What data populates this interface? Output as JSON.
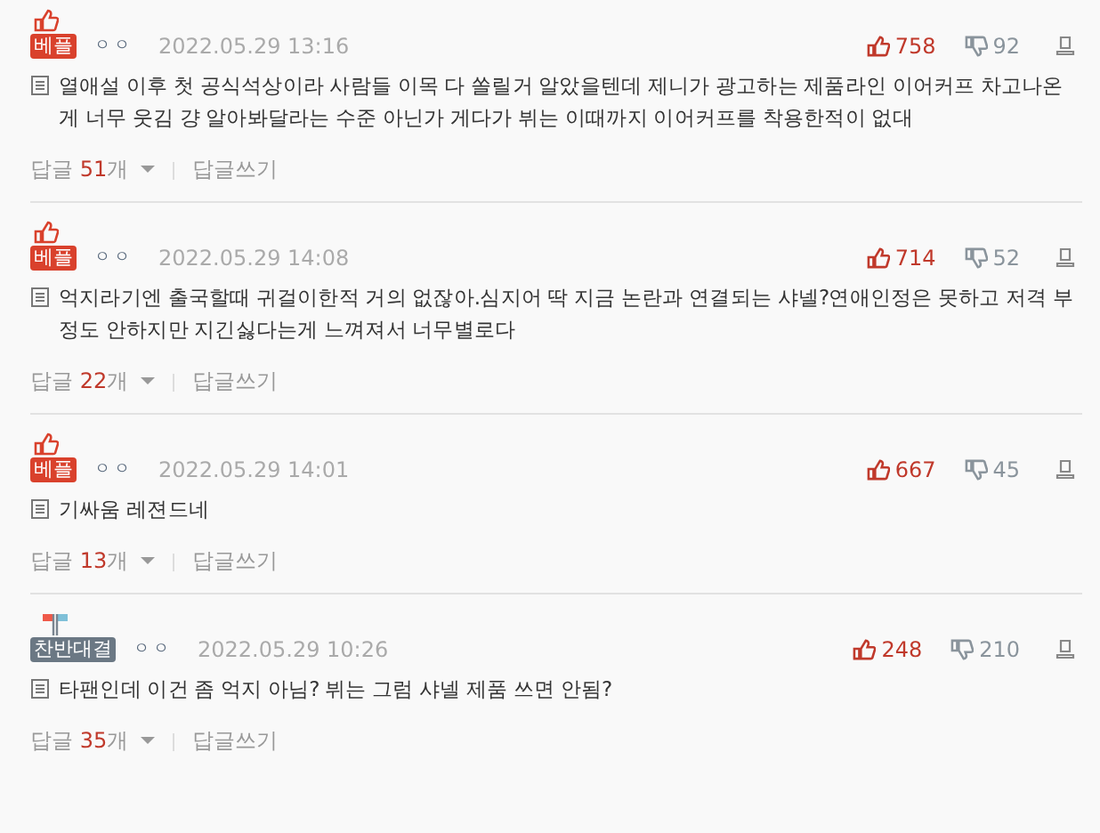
{
  "comments": [
    {
      "badge": {
        "kind": "best",
        "label": "베플"
      },
      "user": "ㅇㅇ",
      "date": "2022.05.29 13:16",
      "likes": "758",
      "dislikes": "92",
      "text": "열애설 이후 첫 공식석상이라 사람들 이목 다 쏠릴거 알았을텐데 제니가 광고하는 제품라인 이어커프 차고나온게 너무 웃김 걍 알아봐달라는 수준 아닌가 게다가 뷔는 이때까지 이어커프를 착용한적이 없대",
      "reply_label": "답글",
      "reply_count": "51",
      "reply_unit": "개",
      "write_reply": "답글쓰기"
    },
    {
      "badge": {
        "kind": "best",
        "label": "베플"
      },
      "user": "ㅇㅇ",
      "date": "2022.05.29 14:08",
      "likes": "714",
      "dislikes": "52",
      "text": "억지라기엔 출국할때 귀걸이한적 거의 없잖아.심지어 딱 지금 논란과 연결되는 샤넬?연애인정은 못하고 저격 부정도 안하지만 지긴싫다는게 느껴져서 너무별로다",
      "reply_label": "답글",
      "reply_count": "22",
      "reply_unit": "개",
      "write_reply": "답글쓰기"
    },
    {
      "badge": {
        "kind": "best",
        "label": "베플"
      },
      "user": "ㅇㅇ",
      "date": "2022.05.29 14:01",
      "likes": "667",
      "dislikes": "45",
      "text": "기싸움 레젼드네",
      "reply_label": "답글",
      "reply_count": "13",
      "reply_unit": "개",
      "write_reply": "답글쓰기"
    },
    {
      "badge": {
        "kind": "versus",
        "label": "찬반대결"
      },
      "user": "ㅇㅇ",
      "date": "2022.05.29 10:26",
      "likes": "248",
      "dislikes": "210",
      "text": "타팬인데 이건 좀 억지 아님? 뷔는 그럼 샤넬 제품 쓰면 안됨?",
      "reply_label": "답글",
      "reply_count": "35",
      "reply_unit": "개",
      "write_reply": "답글쓰기"
    }
  ]
}
